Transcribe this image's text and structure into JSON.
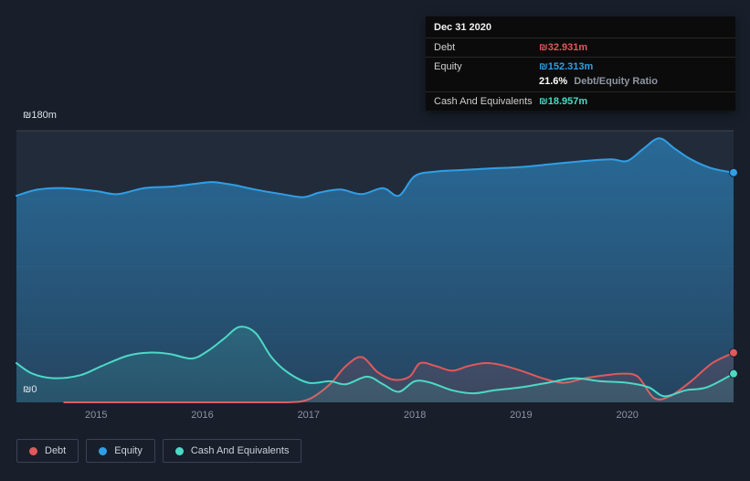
{
  "colors": {
    "debt": "#e0595b",
    "equity": "#2f9fe6",
    "cash": "#4cd9c6",
    "background": "#181f2a",
    "plot_background": "#222b3a",
    "tooltip_background": "#0b0b0b",
    "axis_text": "#8b93a3",
    "grid_top": "#3c4454",
    "grid_faint": "#2a3343"
  },
  "tooltip": {
    "date": "Dec 31 2020",
    "debt_label": "Debt",
    "debt_value": "₪32.931m",
    "equity_label": "Equity",
    "equity_value": "₪152.313m",
    "ratio_value": "21.6%",
    "ratio_label": "Debt/Equity Ratio",
    "cash_label": "Cash And Equivalents",
    "cash_value": "₪18.957m"
  },
  "legend": {
    "items": [
      {
        "label": "Debt",
        "color_key": "debt"
      },
      {
        "label": "Equity",
        "color_key": "equity"
      },
      {
        "label": "Cash And Equivalents",
        "color_key": "cash"
      }
    ]
  },
  "chart_data": {
    "type": "area",
    "title": "Debt, Equity and Cash history to Dec 31 2020",
    "unit": "₪m",
    "x_range": [
      2014.25,
      2021.0
    ],
    "ylim": [
      0,
      180
    ],
    "y_axis_labels": [
      "₪180m",
      "₪0"
    ],
    "y_gridlines": [
      45,
      90,
      135
    ],
    "x_ticks": [
      "2015",
      "2016",
      "2017",
      "2018",
      "2019",
      "2020"
    ],
    "x_tick_values": [
      2015,
      2016,
      2017,
      2018,
      2019,
      2020
    ],
    "legend_position": "bottom-left",
    "series": [
      {
        "name": "Equity",
        "color_key": "equity",
        "end_value": 152.313,
        "points": [
          [
            2014.25,
            137
          ],
          [
            2014.45,
            141
          ],
          [
            2014.7,
            142
          ],
          [
            2015.0,
            140
          ],
          [
            2015.2,
            138
          ],
          [
            2015.45,
            142
          ],
          [
            2015.7,
            143
          ],
          [
            2015.95,
            145
          ],
          [
            2016.1,
            146
          ],
          [
            2016.3,
            144
          ],
          [
            2016.5,
            141
          ],
          [
            2016.75,
            138
          ],
          [
            2016.95,
            136
          ],
          [
            2017.1,
            139
          ],
          [
            2017.3,
            141
          ],
          [
            2017.5,
            138
          ],
          [
            2017.7,
            142
          ],
          [
            2017.85,
            137
          ],
          [
            2018.0,
            150
          ],
          [
            2018.2,
            153
          ],
          [
            2018.45,
            154
          ],
          [
            2018.7,
            155
          ],
          [
            2019.0,
            156
          ],
          [
            2019.3,
            158
          ],
          [
            2019.6,
            160
          ],
          [
            2019.85,
            161
          ],
          [
            2020.0,
            160
          ],
          [
            2020.15,
            168
          ],
          [
            2020.3,
            175
          ],
          [
            2020.45,
            168
          ],
          [
            2020.6,
            161
          ],
          [
            2020.8,
            155
          ],
          [
            2021.0,
            152.3
          ]
        ]
      },
      {
        "name": "Debt",
        "color_key": "debt",
        "end_value": 32.931,
        "points": [
          [
            2014.7,
            0
          ],
          [
            2015.0,
            0
          ],
          [
            2015.5,
            0
          ],
          [
            2016.0,
            0
          ],
          [
            2016.5,
            0
          ],
          [
            2016.8,
            0
          ],
          [
            2017.0,
            2
          ],
          [
            2017.2,
            12
          ],
          [
            2017.35,
            24
          ],
          [
            2017.5,
            30
          ],
          [
            2017.65,
            20
          ],
          [
            2017.8,
            15
          ],
          [
            2017.95,
            17
          ],
          [
            2018.05,
            26
          ],
          [
            2018.2,
            24
          ],
          [
            2018.35,
            21
          ],
          [
            2018.5,
            24
          ],
          [
            2018.65,
            26
          ],
          [
            2018.8,
            25
          ],
          [
            2019.0,
            21
          ],
          [
            2019.2,
            16
          ],
          [
            2019.4,
            13
          ],
          [
            2019.6,
            16
          ],
          [
            2019.8,
            18
          ],
          [
            2019.95,
            19
          ],
          [
            2020.1,
            17
          ],
          [
            2020.25,
            3
          ],
          [
            2020.4,
            4
          ],
          [
            2020.6,
            14
          ],
          [
            2020.8,
            26
          ],
          [
            2021.0,
            32.9
          ]
        ]
      },
      {
        "name": "Cash And Equivalents",
        "color_key": "cash",
        "end_value": 18.957,
        "points": [
          [
            2014.25,
            26
          ],
          [
            2014.4,
            19
          ],
          [
            2014.6,
            16
          ],
          [
            2014.85,
            18
          ],
          [
            2015.05,
            24
          ],
          [
            2015.3,
            31
          ],
          [
            2015.5,
            33
          ],
          [
            2015.7,
            32
          ],
          [
            2015.9,
            29
          ],
          [
            2016.05,
            34
          ],
          [
            2016.2,
            42
          ],
          [
            2016.35,
            50
          ],
          [
            2016.5,
            46
          ],
          [
            2016.65,
            30
          ],
          [
            2016.8,
            20
          ],
          [
            2017.0,
            13
          ],
          [
            2017.2,
            14
          ],
          [
            2017.35,
            12
          ],
          [
            2017.55,
            17
          ],
          [
            2017.7,
            12
          ],
          [
            2017.85,
            7
          ],
          [
            2018.0,
            14
          ],
          [
            2018.15,
            13
          ],
          [
            2018.35,
            8
          ],
          [
            2018.55,
            6
          ],
          [
            2018.75,
            8
          ],
          [
            2019.0,
            10
          ],
          [
            2019.25,
            13
          ],
          [
            2019.5,
            16
          ],
          [
            2019.75,
            14
          ],
          [
            2020.0,
            13
          ],
          [
            2020.2,
            10
          ],
          [
            2020.35,
            4
          ],
          [
            2020.55,
            8
          ],
          [
            2020.75,
            10
          ],
          [
            2021.0,
            19.0
          ]
        ]
      }
    ]
  }
}
